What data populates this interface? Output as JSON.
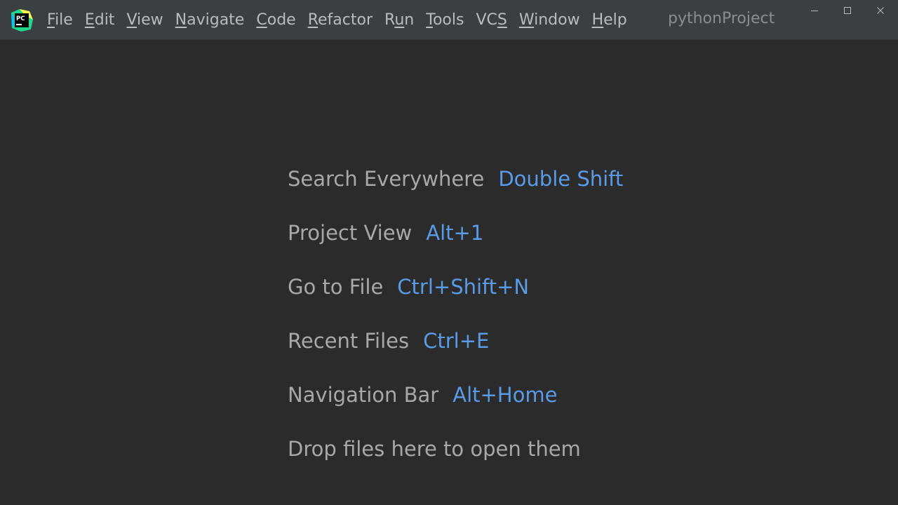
{
  "window": {
    "project_title": "pythonProject",
    "logo_text": "PC",
    "controls": [
      "minimize-icon",
      "maximize-icon",
      "close-icon"
    ]
  },
  "menu": [
    {
      "mnemonic": "F",
      "rest": "ile"
    },
    {
      "mnemonic": "E",
      "rest": "dit"
    },
    {
      "mnemonic": "V",
      "rest": "iew"
    },
    {
      "mnemonic": "N",
      "rest": "avigate"
    },
    {
      "mnemonic": "C",
      "rest": "ode"
    },
    {
      "mnemonic": "R",
      "rest": "efactor"
    },
    {
      "pre": "R",
      "mnemonic": "u",
      "rest": "n"
    },
    {
      "mnemonic": "T",
      "rest": "ools"
    },
    {
      "pre": "VC",
      "mnemonic": "S",
      "rest": ""
    },
    {
      "mnemonic": "W",
      "rest": "indow"
    },
    {
      "mnemonic": "H",
      "rest": "elp"
    }
  ],
  "hints": [
    {
      "label": "Search Everywhere",
      "shortcut": "Double Shift"
    },
    {
      "label": "Project View",
      "shortcut": "Alt+1"
    },
    {
      "label": "Go to File",
      "shortcut": "Ctrl+Shift+N"
    },
    {
      "label": "Recent Files",
      "shortcut": "Ctrl+E"
    },
    {
      "label": "Navigation Bar",
      "shortcut": "Alt+Home"
    }
  ],
  "drop_text": "Drop files here to open them",
  "colors": {
    "background": "#2b2b2b",
    "titlebar": "#3c3f41",
    "menu_text": "#bbbbbb",
    "hint_text": "#a8a8a8",
    "shortcut_text": "#5a9be8"
  }
}
